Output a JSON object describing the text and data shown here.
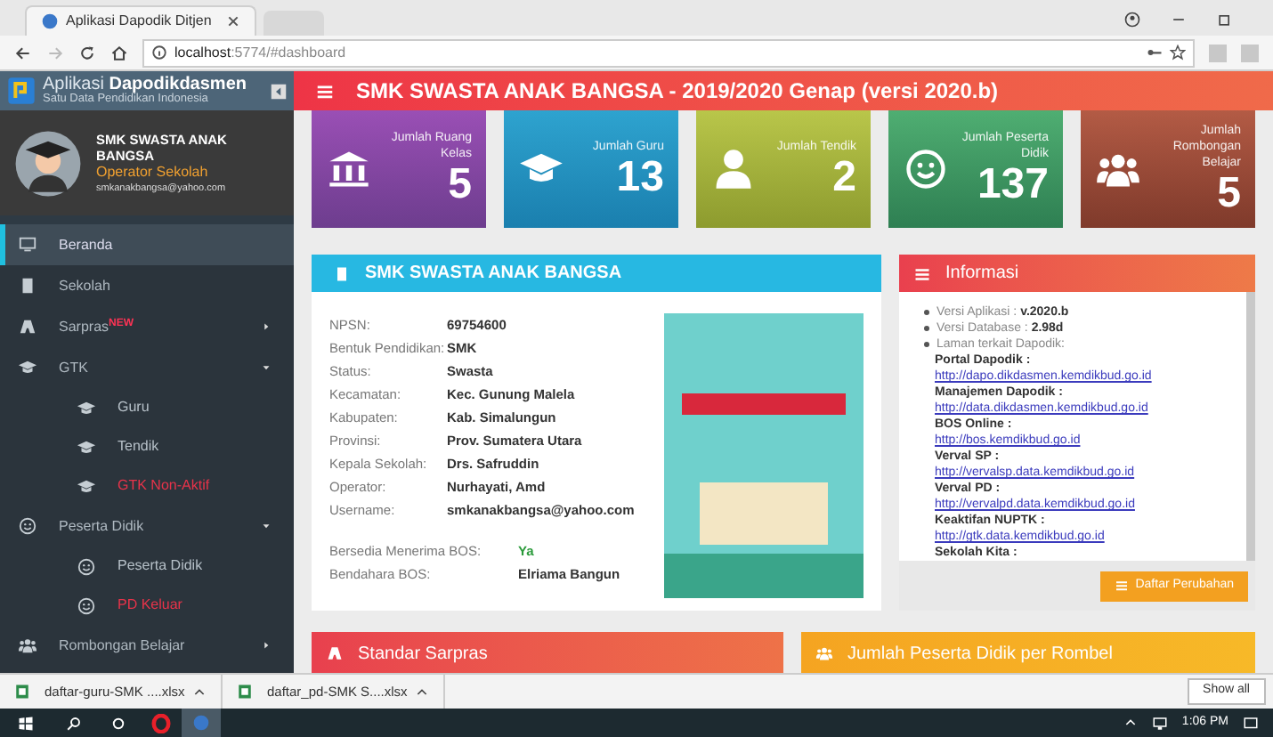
{
  "browser": {
    "tab_title": "Aplikasi Dapodik Ditjen",
    "url_host": "localhost",
    "url_path": ":5774/#dashboard"
  },
  "sidebar": {
    "app_name_light": "Aplikasi",
    "app_name_bold": "Dapodikdasmen",
    "app_subtitle": "Satu Data Pendidikan Indonesia",
    "profile": {
      "name": "SMK SWASTA ANAK BANGSA",
      "role": "Operator Sekolah",
      "email": "smkanakbangsa@yahoo.com"
    },
    "items": [
      {
        "label": "Beranda",
        "selected": true
      },
      {
        "label": "Sekolah",
        "selected": false
      },
      {
        "label": "Sarpras",
        "badge": "NEW",
        "selected": false,
        "expanded": false
      },
      {
        "label": "GTK",
        "selected": false,
        "expanded": true,
        "children": [
          {
            "label": "Guru",
            "selected": false
          },
          {
            "label": "Tendik",
            "selected": false
          },
          {
            "label": "GTK Non-Aktif",
            "selected": false,
            "color": "#e8334a"
          }
        ]
      },
      {
        "label": "Peserta Didik",
        "selected": false,
        "expanded": true,
        "children": [
          {
            "label": "Peserta Didik",
            "selected": false
          },
          {
            "label": "PD Keluar",
            "selected": false,
            "color": "#e8334a"
          }
        ]
      },
      {
        "label": "Rombongan Belajar",
        "selected": false,
        "expanded": false
      }
    ]
  },
  "header": {
    "title": "SMK SWASTA ANAK BANGSA - 2019/2020 Genap (versi 2020.b)"
  },
  "tiles": [
    {
      "label": "Jumlah Ruang Kelas",
      "value": "5"
    },
    {
      "label": "Jumlah Guru",
      "value": "13"
    },
    {
      "label": "Jumlah Tendik",
      "value": "2"
    },
    {
      "label": "Jumlah Peserta Didik",
      "value": "137"
    },
    {
      "label": "Jumlah Rombongan Belajar",
      "value": "5"
    }
  ],
  "school": {
    "title": "SMK SWASTA ANAK BANGSA",
    "fields": [
      {
        "label": "NPSN:",
        "value": "69754600"
      },
      {
        "label": "Bentuk Pendidikan:",
        "value": "SMK"
      },
      {
        "label": "Status:",
        "value": "Swasta"
      },
      {
        "label": "Kecamatan:",
        "value": "Kec. Gunung Malela"
      },
      {
        "label": "Kabupaten:",
        "value": "Kab. Simalungun"
      },
      {
        "label": "Provinsi:",
        "value": "Prov. Sumatera Utara"
      },
      {
        "label": "Kepala Sekolah:",
        "value": "Drs. Safruddin"
      },
      {
        "label": "Operator:",
        "value": "Nurhayati, Amd"
      },
      {
        "label": "Username:",
        "value": "smkanakbangsa@yahoo.com"
      }
    ],
    "bos": [
      {
        "label": "Bersedia Menerima BOS:",
        "value": "Ya",
        "positive": true
      },
      {
        "label": "Bendahara BOS:",
        "value": "Elriama Bangun",
        "positive": false
      }
    ]
  },
  "info": {
    "title": "Informasi",
    "bullets": [
      "Versi Aplikasi : **v.2020.b**",
      "Versi Database : **2.98d**",
      "Laman terkait Dapodik:"
    ],
    "links": [
      {
        "name": "Portal Dapodik :",
        "url": "http://dapo.dikdasmen.kemdikbud.go.id"
      },
      {
        "name": "Manajemen Dapodik :",
        "url": "http://data.dikdasmen.kemdikbud.go.id"
      },
      {
        "name": "BOS Online :",
        "url": "http://bos.kemdikbud.go.id"
      },
      {
        "name": "Verval SP :",
        "url": "http://vervalsp.data.kemdikbud.go.id"
      },
      {
        "name": "Verval PD :",
        "url": "http://vervalpd.data.kemdikbud.go.id"
      },
      {
        "name": "Keaktifan NUPTK :",
        "url": "http://gtk.data.kemdikbud.go.id"
      },
      {
        "name": "Sekolah Kita :"
      }
    ],
    "button": "Daftar Perubahan"
  },
  "bottom_cards": [
    {
      "title": "Standar Sarpras"
    },
    {
      "title": "Jumlah Peserta Didik per Rombel"
    }
  ],
  "downloads": {
    "files": [
      "daftar-guru-SMK ....xlsx",
      "daftar_pd-SMK S....xlsx"
    ],
    "show_all": "Show all"
  },
  "taskbar": {
    "time": "1:06 PM"
  }
}
